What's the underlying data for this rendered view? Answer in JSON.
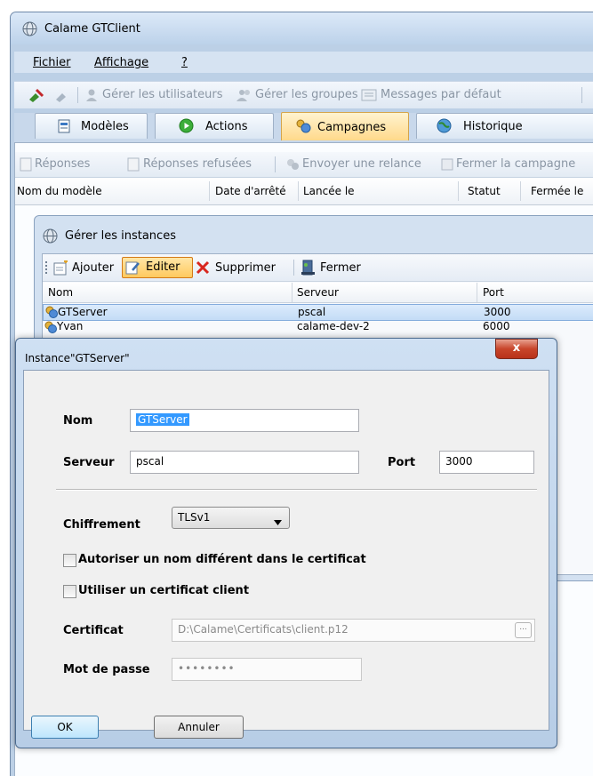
{
  "app": {
    "title": "Calame GTClient",
    "icon": "app-globe-icon"
  },
  "menu": {
    "items": [
      "Fichier",
      "Affichage",
      "?"
    ]
  },
  "toolbar1": {
    "manage_users": "Gérer les utilisateurs",
    "manage_groups": "Gérer les groupes",
    "default_messages": "Messages par défaut"
  },
  "tabs": [
    {
      "label": "Modèles",
      "icon": "document-icon"
    },
    {
      "label": "Actions",
      "icon": "play-icon"
    },
    {
      "label": "Campagnes",
      "icon": "users-icon"
    },
    {
      "label": "Historique",
      "icon": "globe-icon"
    }
  ],
  "active_tab": "Campagnes",
  "toolbar2": {
    "responses": "Réponses",
    "refused_responses": "Réponses refusées",
    "send_reminder": "Envoyer une relance",
    "close_campaign": "Fermer la campagne"
  },
  "table": {
    "columns": [
      "Nom du modèle",
      "Date d'arrêté",
      "Lancée le",
      "Statut",
      "Fermée le"
    ]
  },
  "instances_window": {
    "title": "Gérer les instances",
    "toolbar": {
      "add": "Ajouter",
      "edit": "Editer",
      "delete": "Supprimer",
      "close": "Fermer"
    },
    "columns": [
      "Nom",
      "Serveur",
      "Port"
    ],
    "rows": [
      {
        "name": "GTServer",
        "server": "pscal",
        "port": "3000"
      },
      {
        "name": "Yvan",
        "server": "calame-dev-2",
        "port": "6000"
      }
    ]
  },
  "dialog": {
    "title": "Instance\"GTServer\"",
    "close_label": "x",
    "name_label": "Nom",
    "name_value": "GTServer",
    "server_label": "Serveur",
    "server_value": "pscal",
    "port_label": "Port",
    "port_value": "3000",
    "cipher_label": "Chiffrement",
    "cipher_value": "TLSv1",
    "allow_name_label": "Autoriser un nom différent dans le certificat",
    "client_cert_label": "Utiliser un certificat client",
    "cert_label": "Certificat",
    "cert_value": "D:\\Calame\\Certificats\\client.p12",
    "browse_label": "...",
    "password_label": "Mot de passe",
    "password_value": "••••••••",
    "ok_label": "OK",
    "cancel_label": "Annuler"
  }
}
